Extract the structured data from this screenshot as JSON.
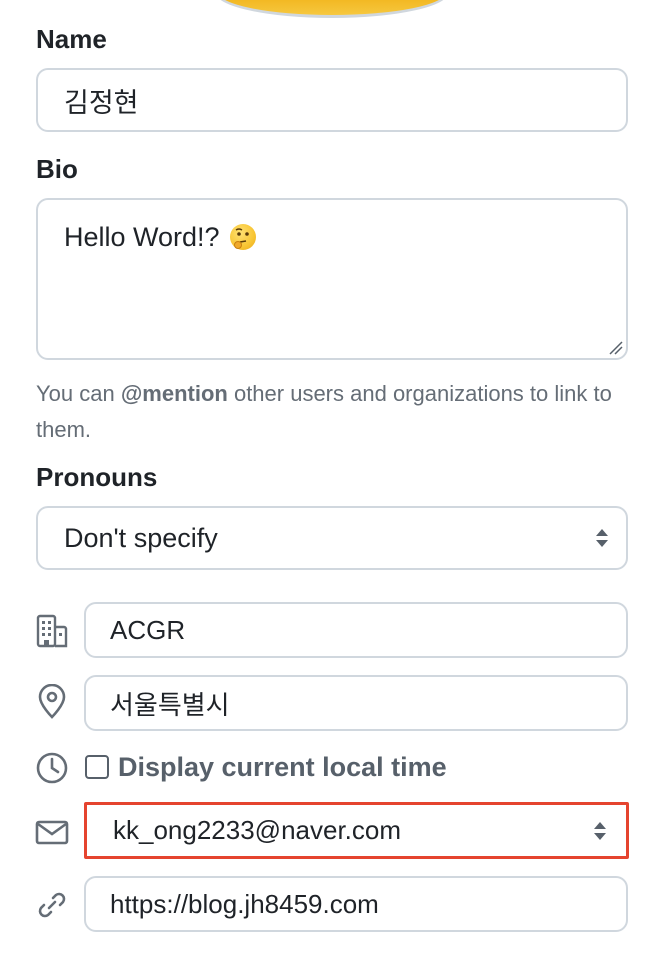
{
  "profile": {
    "name_label": "Name",
    "name_value": "김정현",
    "bio_label": "Bio",
    "bio_value": "Hello Word!?",
    "bio_emoji": "thinking-face-emoji",
    "help_prefix": "You can ",
    "help_mention": "@mention",
    "help_suffix": " other users and organizations to link to them.",
    "pronouns_label": "Pronouns",
    "pronouns_value": "Don't specify",
    "company_value": "ACGR",
    "location_value": "서울특별시",
    "local_time_label": "Display current local time",
    "local_time_checked": false,
    "email_value": "kk_ong2233@naver.com",
    "website_value": "https://blog.jh8459.com"
  },
  "icons": {
    "company": "building-icon",
    "location": "location-pin-icon",
    "time": "clock-icon",
    "email": "mail-icon",
    "website": "link-icon"
  },
  "colors": {
    "text": "#1f2328",
    "muted": "#656d76",
    "border": "#d0d7de",
    "highlight": "#e5442f",
    "icon": "#656d76"
  }
}
